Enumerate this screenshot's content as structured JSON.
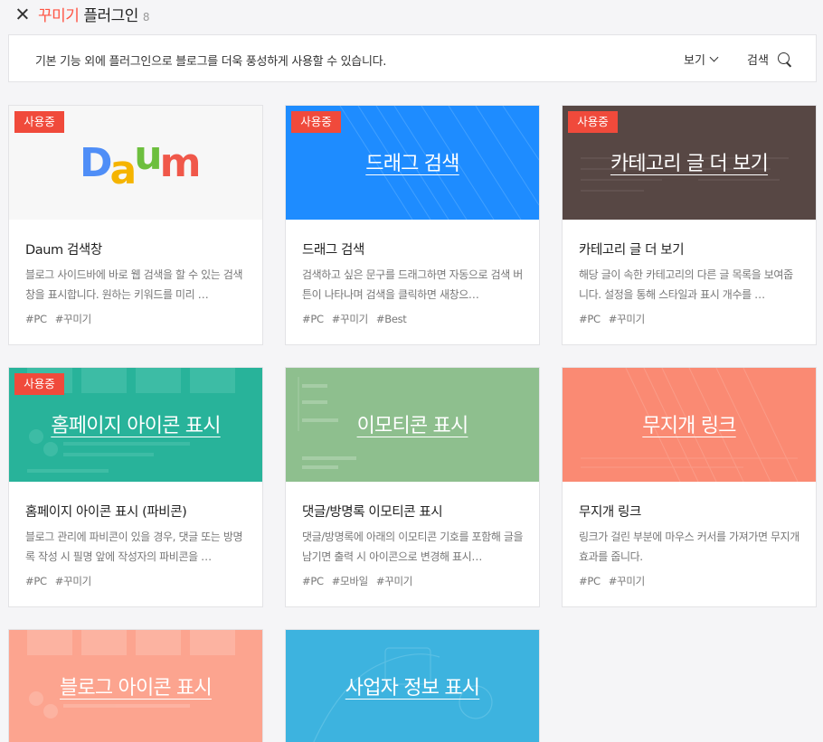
{
  "header": {
    "title_accent": "꾸미기",
    "title_rest": "플러그인",
    "count": "8"
  },
  "infobar": {
    "description": "기본 기능 외에 플러그인으로 블로그를 더욱 풍성하게 사용할 수 있습니다.",
    "view_label": "보기",
    "search_label": "검색"
  },
  "badge_label": "사용중",
  "colors": {
    "accent": "#ff5544",
    "badge": "#f04a3b",
    "drag_search": "#1e8cff",
    "category": "#574744",
    "favicon": "#28b39a",
    "emoticon": "#8ebf8e",
    "rainbow": "#fa8a73",
    "blog_icon": "#fca48f",
    "business": "#3db3df"
  },
  "cards": [
    {
      "thumb_label": "",
      "logo": "Daum",
      "in_use": true,
      "title": "Daum 검색창",
      "description": "블로그 사이드바에 바로 웹 검색을 할 수 있는 검색창을 표시합니다. 원하는 키워드를 미리 …",
      "tags": [
        "#PC",
        "#꾸미기"
      ]
    },
    {
      "thumb_label": "드래그 검색",
      "in_use": true,
      "title": "드래그 검색",
      "description": "검색하고 싶은 문구를 드래그하면 자동으로 검색 버튼이 나타나며 검색을 클릭하면 새창으…",
      "tags": [
        "#PC",
        "#꾸미기",
        "#Best"
      ]
    },
    {
      "thumb_label": "카테고리 글 더 보기",
      "in_use": true,
      "title": "카테고리 글 더 보기",
      "description": "해당 글이 속한 카테고리의 다른 글 목록을 보여줍니다. 설정을 통해 스타일과 표시 개수를 …",
      "tags": [
        "#PC",
        "#꾸미기"
      ]
    },
    {
      "thumb_label": "홈페이지 아이콘 표시",
      "in_use": true,
      "title": "홈페이지 아이콘 표시 (파비콘)",
      "description": "블로그 관리에 파비콘이 있을 경우, 댓글 또는 방명록 작성 시 필명 앞에 작성자의 파비콘을 …",
      "tags": [
        "#PC",
        "#꾸미기"
      ]
    },
    {
      "thumb_label": "이모티콘 표시",
      "in_use": false,
      "title": "댓글/방명록 이모티콘 표시",
      "description": "댓글/방명록에 아래의 이모티콘 기호를 포함해 글을 남기면 출력 시 아이콘으로 변경해 표시…",
      "tags": [
        "#PC",
        "#모바일",
        "#꾸미기"
      ]
    },
    {
      "thumb_label": "무지개 링크",
      "in_use": false,
      "title": "무지개 링크",
      "description": "링크가 걸린 부분에 마우스 커서를 가져가면 무지개 효과를 줍니다.",
      "tags": [
        "#PC",
        "#꾸미기"
      ]
    },
    {
      "thumb_label": "블로그 아이콘 표시",
      "in_use": false,
      "title": "",
      "description": "",
      "tags": []
    },
    {
      "thumb_label": "사업자 정보 표시",
      "in_use": false,
      "title": "",
      "description": "",
      "tags": []
    }
  ]
}
